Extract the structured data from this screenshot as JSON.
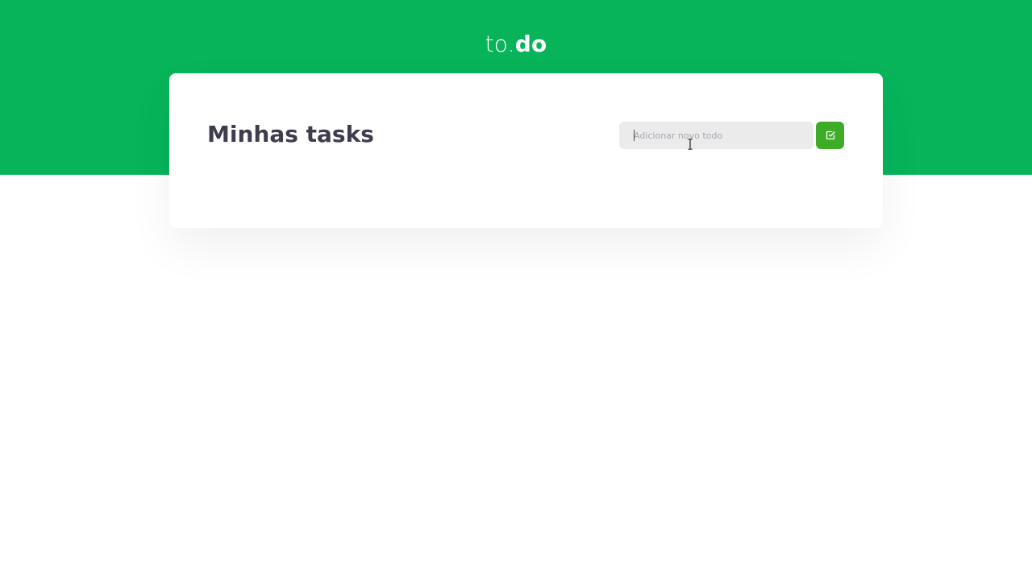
{
  "header": {
    "background_color": "#07b45a",
    "logo_prefix": "to.",
    "logo_suffix": "do"
  },
  "main": {
    "title": "Minhas tasks",
    "new_todo": {
      "placeholder": "Adicionar novo todo",
      "value": "",
      "submit_icon": "check-square-icon",
      "submit_color": "#3fac28"
    }
  },
  "cursor": {
    "type": "text-cursor-icon"
  }
}
